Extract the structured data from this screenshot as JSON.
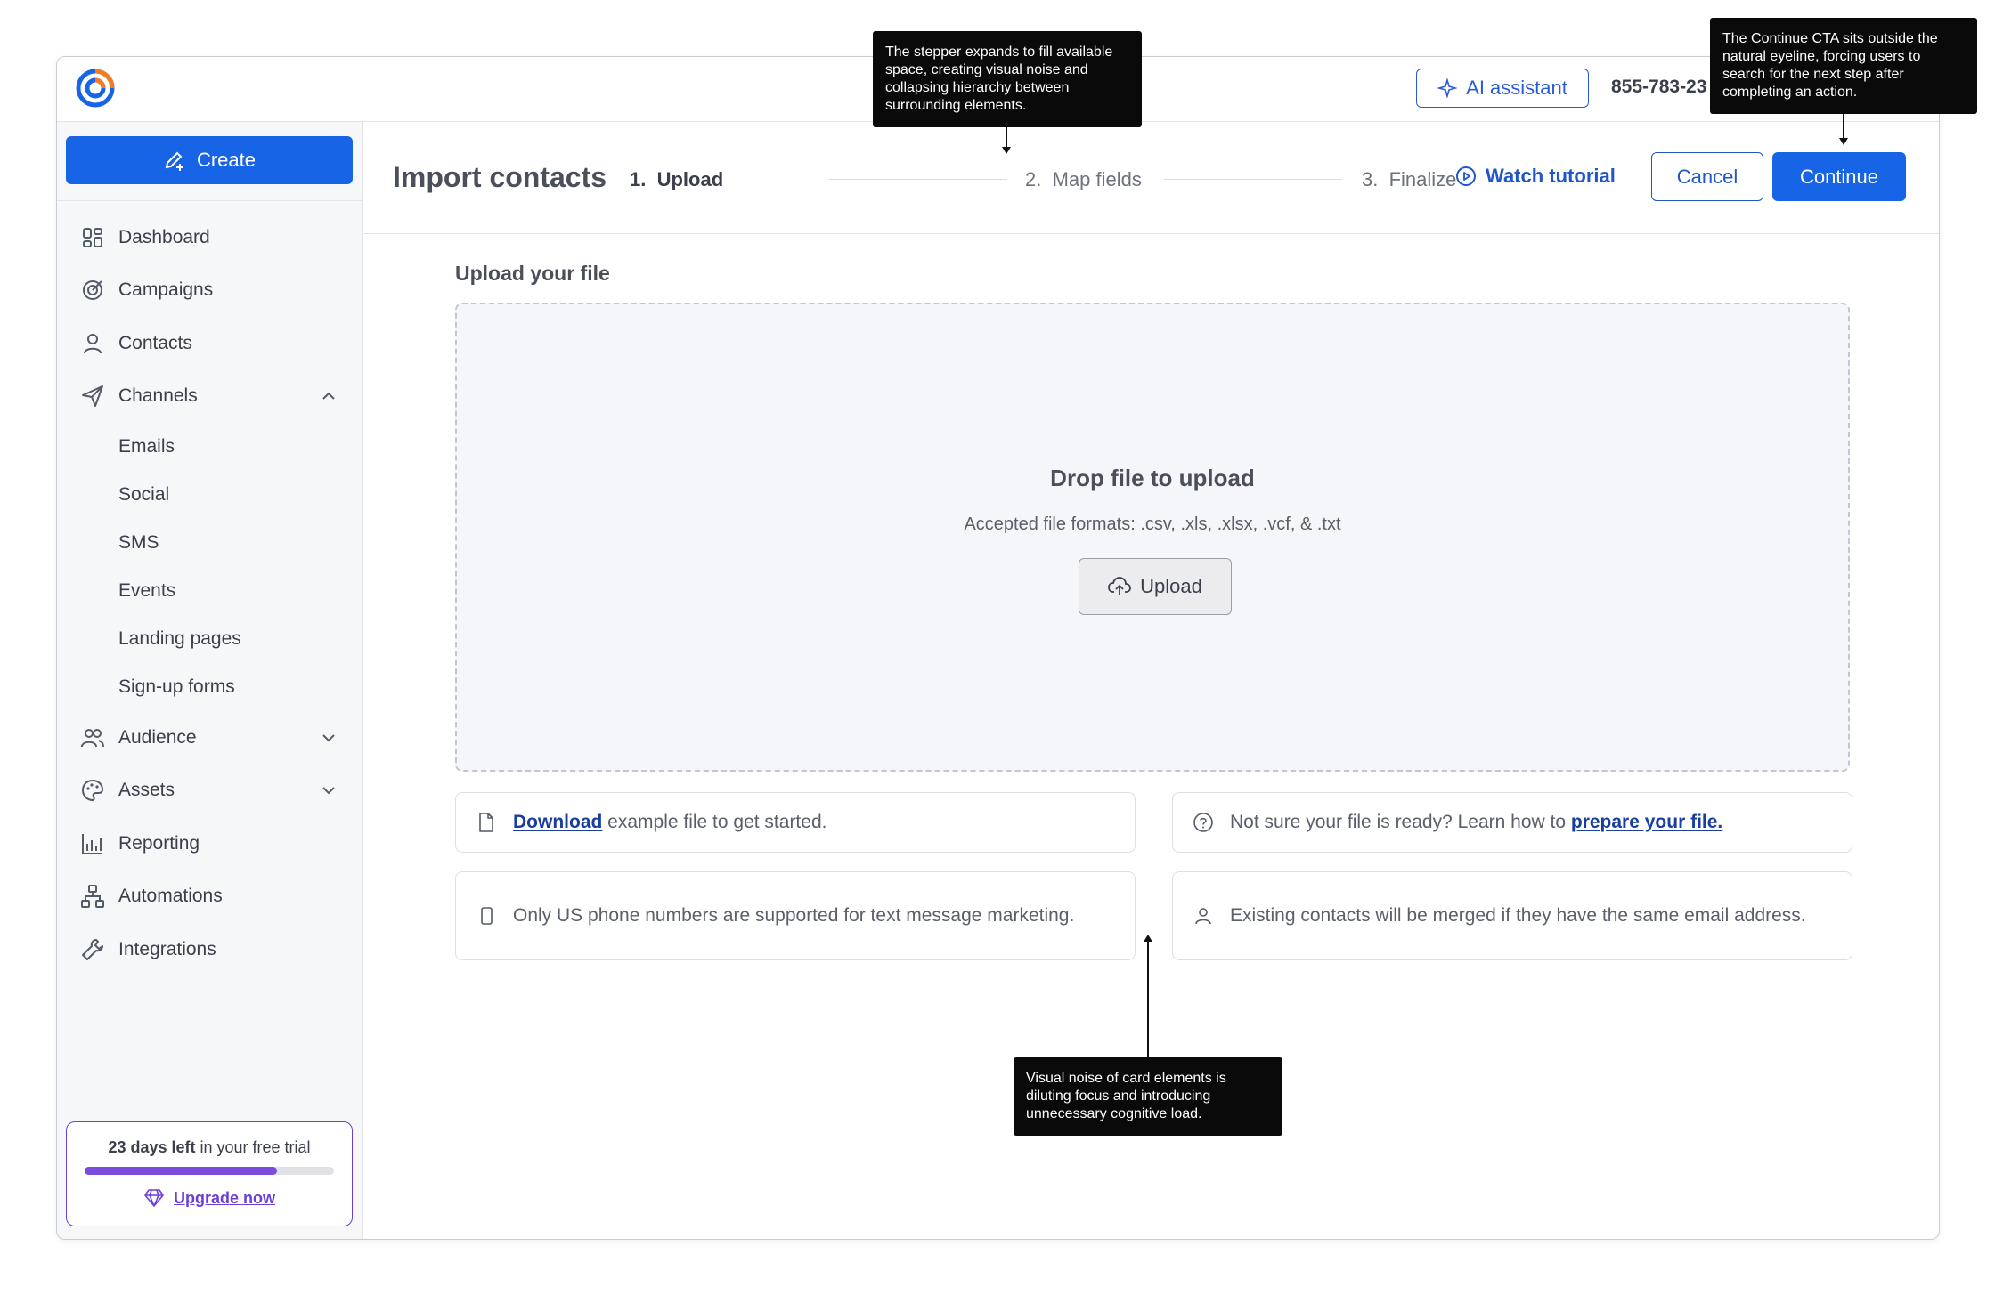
{
  "topbar": {
    "ai_label": "AI assistant",
    "phone": "855-783-23"
  },
  "sidebar": {
    "create_label": "Create",
    "items": [
      {
        "label": "Dashboard",
        "icon": "dashboard-icon"
      },
      {
        "label": "Campaigns",
        "icon": "campaigns-icon"
      },
      {
        "label": "Contacts",
        "icon": "person-icon"
      },
      {
        "label": "Channels",
        "icon": "send-icon",
        "expanded": true
      }
    ],
    "channels_sub": [
      "Emails",
      "Social",
      "SMS",
      "Events",
      "Landing pages",
      "Sign-up forms"
    ],
    "items_after": [
      {
        "label": "Audience",
        "icon": "audience-icon",
        "expanded": false
      },
      {
        "label": "Assets",
        "icon": "palette-icon",
        "expanded": false
      },
      {
        "label": "Reporting",
        "icon": "chart-icon"
      },
      {
        "label": "Automations",
        "icon": "flow-icon"
      },
      {
        "label": "Integrations",
        "icon": "wrench-icon"
      }
    ],
    "trial": {
      "days_bold": "23 days left",
      "days_rest": " in your free trial",
      "progress": 0.77,
      "upgrade_label": "Upgrade now"
    }
  },
  "header": {
    "title": "Import contacts",
    "steps": [
      {
        "num": "1.",
        "label": "Upload",
        "active": true
      },
      {
        "num": "2.",
        "label": "Map fields",
        "active": false
      },
      {
        "num": "3.",
        "label": "Finalize",
        "active": false
      }
    ],
    "watch_label": "Watch tutorial",
    "cancel_label": "Cancel",
    "continue_label": "Continue"
  },
  "upload": {
    "section_title": "Upload your file",
    "drop_title": "Drop file to upload",
    "formats": "Accepted file formats: .csv, .xls, .xlsx, .vcf, & .txt",
    "button_label": "Upload"
  },
  "cards": {
    "download_link": "Download",
    "download_rest": " example file to get started.",
    "prepare_text": "Not sure your file is ready? Learn how to ",
    "prepare_link": "prepare your file.",
    "phone_text": "Only US phone numbers are supported for text message marketing.",
    "merge_text": "Existing contacts will be merged if they have the same email address."
  },
  "annotations": {
    "stepper": "The stepper expands to fill available space, creating visual noise and collapsing hierarchy between surrounding elements.",
    "continue": "The Continue CTA sits outside the natural eyeline, forcing users to search for the next step after completing an action.",
    "cards": "Visual noise of card elements is diluting focus and introducing unnecessary cognitive load."
  },
  "colors": {
    "primary": "#1864e6",
    "link": "#1a3e9e",
    "trial_accent": "#7c4ddc"
  }
}
